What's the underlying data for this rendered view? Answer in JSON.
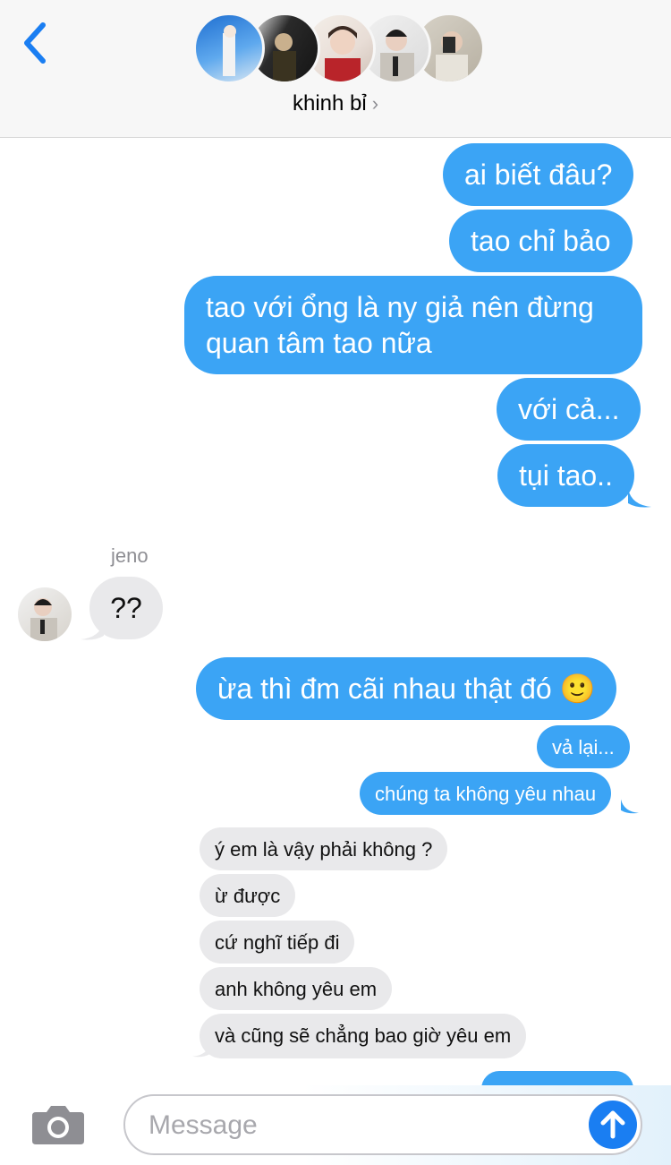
{
  "header": {
    "title": "khinh bỉ",
    "avatars": [
      "member-1",
      "member-2",
      "member-3",
      "member-4",
      "member-5"
    ]
  },
  "messages": {
    "out_1": "ai biết đâu?",
    "out_2": "tao chỉ bảo",
    "out_3_line1": "tao với ổng là ny giả nên đừng",
    "out_3_line2": "quan tâm tao nữa",
    "out_4": "với cả...",
    "out_5": "tụi tao..",
    "sender_name": "jeno",
    "in_1": "??",
    "out_6": "ừa thì đm cãi nhau thật đó 🙂",
    "out_7": "vả lại...",
    "out_8": "chúng ta không yêu nhau",
    "in_2": "ý em là vậy phải không ?",
    "in_3": "ừ được",
    "in_4": "cứ nghĩ tiếp đi",
    "in_5": "anh không yêu em",
    "in_6": "và cũng sẽ chẳng bao giờ yêu em"
  },
  "composer": {
    "placeholder": "Message"
  },
  "colors": {
    "outgoing": "#3ba4f5",
    "incoming": "#e9e9eb",
    "accent": "#1a7ef2"
  }
}
